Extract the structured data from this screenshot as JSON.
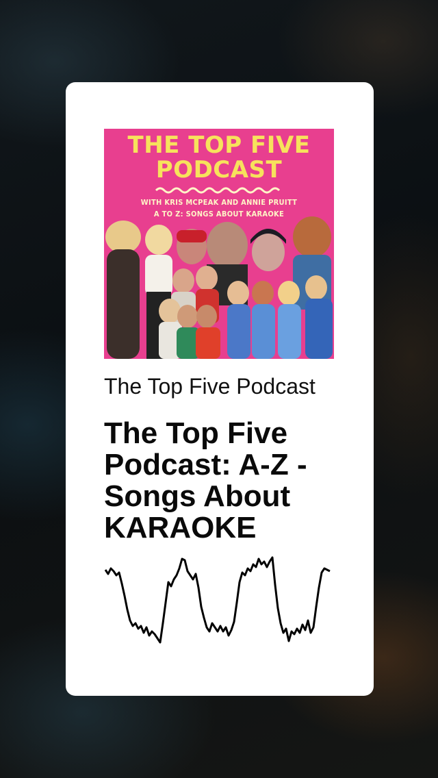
{
  "cover": {
    "title": "THE TOP FIVE\nPODCAST",
    "subtitle_line1": "WITH KRIS MCPEAK AND ANNIE PRUITT",
    "subtitle_line2": "A TO Z: SONGS ABOUT KARAOKE"
  },
  "show_name": "The Top Five Podcast",
  "episode_title": "The Top Five Podcast: A-Z - Songs About KARAOKE",
  "colors": {
    "cover_background": "#e83f8f",
    "cover_title": "#f7e25c",
    "card_background": "#ffffff",
    "waveform": "#000000"
  }
}
